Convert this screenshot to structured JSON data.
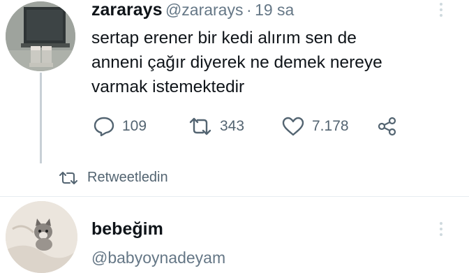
{
  "tweet1": {
    "display_name": "zararays",
    "handle": "@zararays",
    "separator": "·",
    "time": "19 sa",
    "body_lines": [
      "sertap erener bir kedi alırım sen de",
      "anneni çağır diyerek ne demek nereye",
      "varmak istemektedir"
    ],
    "replies": "109",
    "retweets": "343",
    "likes": "7.178",
    "avatar_icon": "profile-photo"
  },
  "retweeted_label": "Retweetledin",
  "tweet2": {
    "display_name": "bebeğim",
    "handle": "@babyoynadeyam",
    "avatar_icon": "kitten-photo"
  },
  "icons": {
    "reply": "reply-icon",
    "retweet": "retweet-icon",
    "like": "heart-icon",
    "share": "share-icon",
    "more": "more-icon"
  },
  "colors": {
    "text": "#0f1419",
    "muted": "#536471",
    "thread_line": "#c8d0d6"
  }
}
